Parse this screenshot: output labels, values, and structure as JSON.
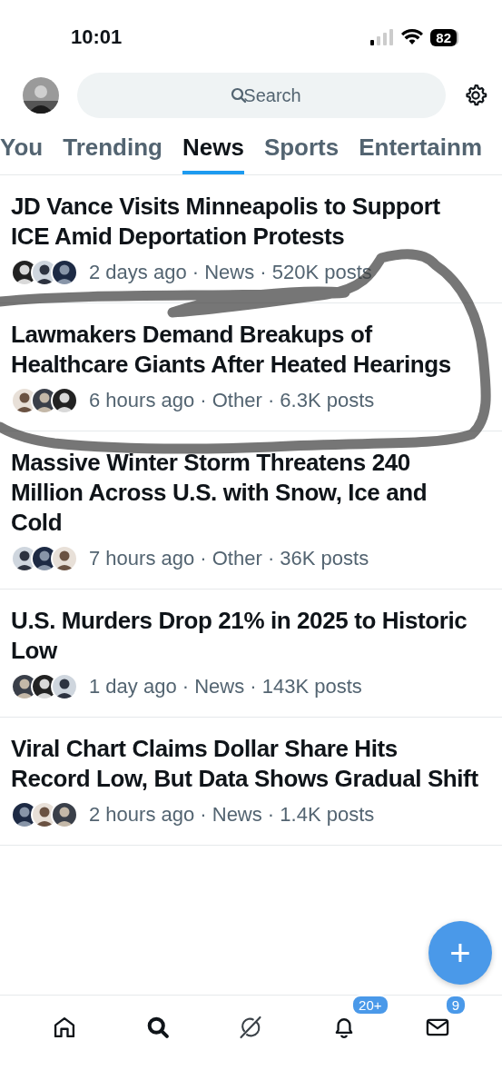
{
  "status_bar": {
    "time": "10:01",
    "battery": "82"
  },
  "search": {
    "placeholder": "Search"
  },
  "tabs": [
    {
      "label": "You",
      "selected": false
    },
    {
      "label": "Trending",
      "selected": false
    },
    {
      "label": "News",
      "selected": true
    },
    {
      "label": "Sports",
      "selected": false
    },
    {
      "label": "Entertainm",
      "selected": false
    }
  ],
  "stories": [
    {
      "title": "JD Vance Visits Minneapolis to Support ICE Amid Deportation Protests",
      "meta": "2 days ago · News · 520K posts"
    },
    {
      "title": "Lawmakers Demand Breakups of Healthcare Giants After Heated Hearings",
      "meta": "6 hours ago · Other · 6.3K posts"
    },
    {
      "title": "Massive Winter Storm Threatens 240 Million Across U.S. with Snow, Ice and Cold",
      "meta": "7 hours ago · Other · 36K posts"
    },
    {
      "title": "U.S. Murders Drop 21% in 2025 to Historic Low",
      "meta": "1 day ago · News · 143K posts"
    },
    {
      "title": "Viral Chart Claims Dollar Share Hits Record Low, But Data Shows Gradual Shift",
      "meta": "2 hours ago · News · 1.4K posts"
    }
  ],
  "compose_button": {
    "label": "+"
  },
  "nav": [
    {
      "kind": "home",
      "selected": false
    },
    {
      "kind": "search",
      "selected": true
    },
    {
      "kind": "grok",
      "selected": false
    },
    {
      "kind": "bell",
      "selected": false,
      "badge": "20+"
    },
    {
      "kind": "mail",
      "selected": false,
      "badge": "9"
    }
  ]
}
